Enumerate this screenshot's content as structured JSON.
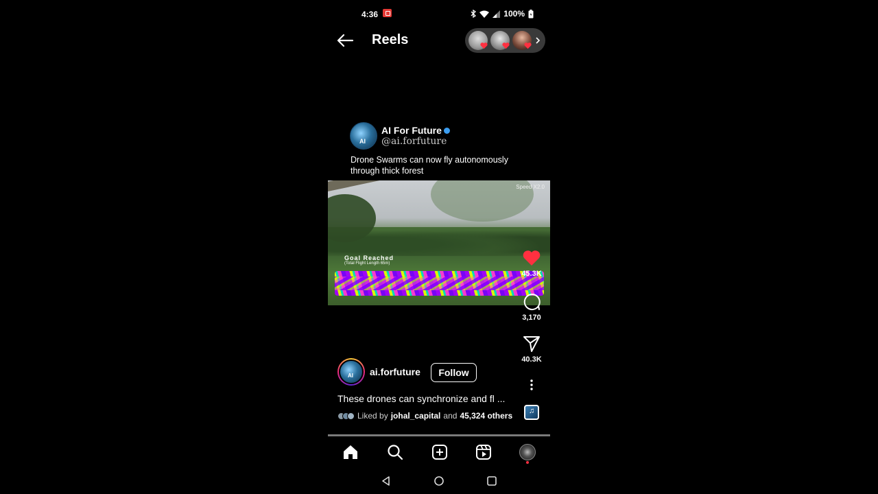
{
  "status": {
    "time": "4:36",
    "battery": "100%"
  },
  "header": {
    "title": "Reels"
  },
  "post": {
    "card_name": "AI For Future",
    "card_handle": "@ai.forfuture",
    "avatar_text": "AI",
    "card_caption": "Drone Swarms can now fly autonomously through thick forest",
    "video_speed": "Speed X2.0",
    "video_goal": "Goal Reached",
    "video_goal_sub": "(Total Flight Length 65m)"
  },
  "rail": {
    "likes": "45.3K",
    "comments": "3,170",
    "shares": "40.3K"
  },
  "author": {
    "username": "ai.forfuture",
    "follow_label": "Follow",
    "description": "These drones can synchronize and fl ...",
    "likes_prefix": "Liked by",
    "likes_user": "johal_capital",
    "likes_and": "and",
    "likes_others": "45,324 others"
  },
  "colors": {
    "heart": "#ff3040",
    "verified": "#3b9df0",
    "background": "#000000"
  },
  "icons": [
    "back-arrow-icon",
    "heart-icon",
    "comment-icon",
    "share-icon",
    "more-icon",
    "home-icon",
    "search-icon",
    "create-icon",
    "reels-icon",
    "profile-icon",
    "android-back-icon",
    "android-home-icon",
    "android-recents-icon"
  ]
}
